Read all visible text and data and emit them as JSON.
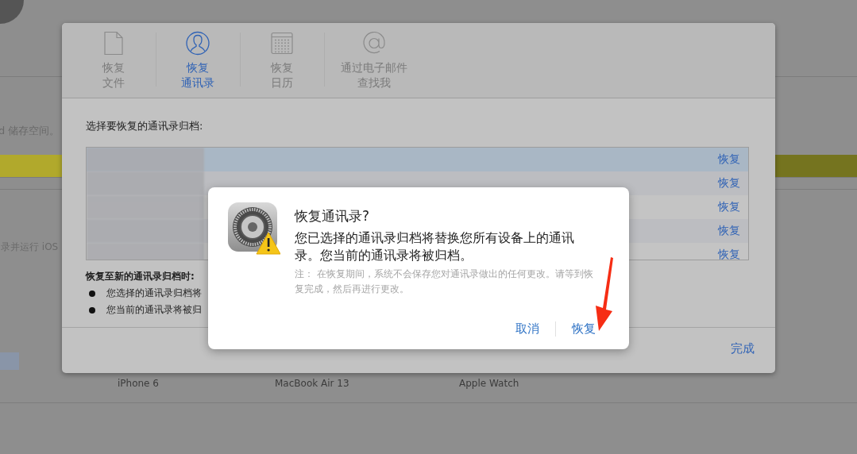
{
  "background": {
    "storage_text": "d 储存空间。",
    "signin_text": "录并运行 iOS",
    "devices": [
      "iPhone 6",
      "MacBook Air 13",
      "Apple Watch"
    ]
  },
  "tabs": [
    {
      "kind": "file",
      "line1": "恢复",
      "line2": "文件",
      "selected": false
    },
    {
      "kind": "contacts",
      "line1": "恢复",
      "line2": "通讯录",
      "selected": true
    },
    {
      "kind": "calendar",
      "line1": "恢复",
      "line2": "日历",
      "selected": false
    },
    {
      "kind": "email",
      "line1": "通过电子邮件",
      "line2": "查找我",
      "selected": false
    }
  ],
  "prompt": "选择要恢复的通讯录归档:",
  "archives": [
    {
      "action": "恢复",
      "selected": true
    },
    {
      "action": "恢复",
      "selected": false
    },
    {
      "action": "恢复",
      "selected": false
    },
    {
      "action": "恢复",
      "selected": false
    },
    {
      "action": "恢复",
      "selected": false
    }
  ],
  "notes_heading": "恢复至新的通讯录归档时:",
  "notes": [
    "您选择的通讯录归档将",
    "您当前的通讯录将被归"
  ],
  "done": "完成",
  "alert": {
    "title": "恢复通讯录?",
    "message": "您已选择的通讯录归档将替换您所有设备上的通讯录。您当前的通讯录将被归档。",
    "note": "注：  在恢复期间，系统不会保存您对通讯录做出的任何更改。请等到恢复完成，然后再进行更改。",
    "buttons": [
      "取消",
      "恢复"
    ]
  }
}
